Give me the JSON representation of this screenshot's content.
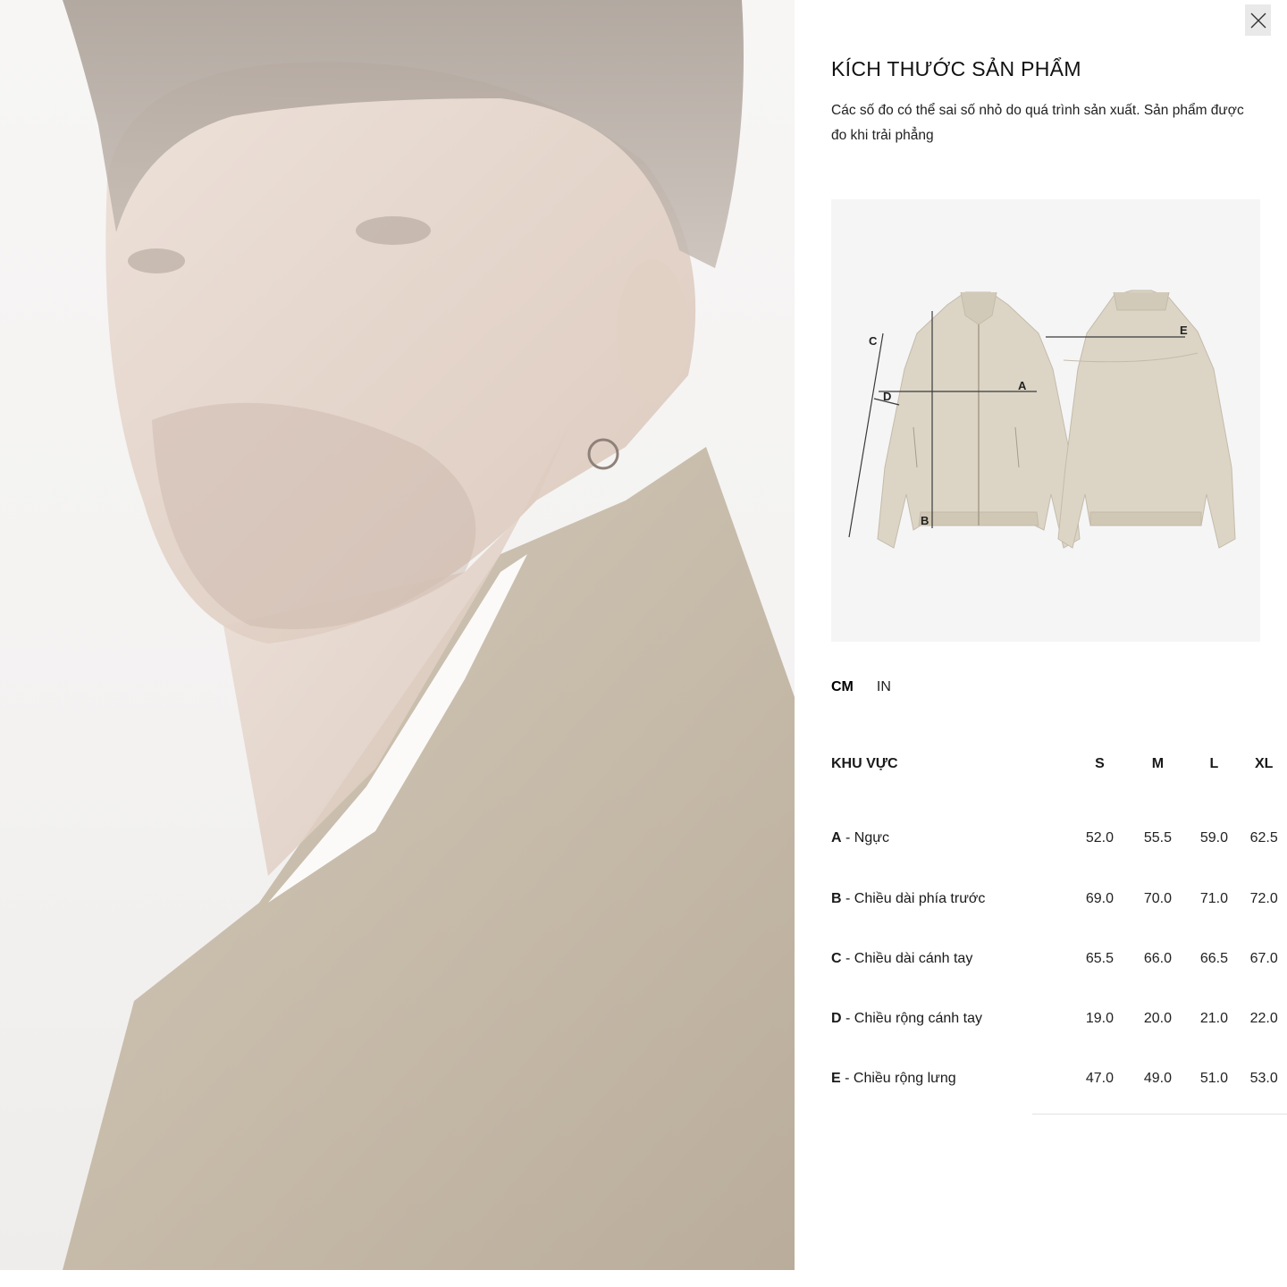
{
  "modal": {
    "title": "KÍCH THƯỚC SẢN PHẨM",
    "description": "Các số đo có thể sai số nhỏ do quá trình sản xuất. Sản phẩm được đo khi trải phẳng",
    "close_icon": "close-icon"
  },
  "diagram": {
    "labels": {
      "a": "A",
      "b": "B",
      "c": "C",
      "d": "D",
      "e": "E"
    },
    "jacket_color": "#d9d2c3"
  },
  "units": {
    "cm": "CM",
    "in": "IN",
    "selected": "cm"
  },
  "table": {
    "region_header": "KHU VỰC",
    "sizes": [
      "S",
      "M",
      "L",
      "XL"
    ],
    "rows": [
      {
        "key": "A",
        "name": " - Ngực",
        "values": [
          "52.0",
          "55.5",
          "59.0",
          "62.5"
        ]
      },
      {
        "key": "B",
        "name": " - Chiều dài phía trước",
        "values": [
          "69.0",
          "70.0",
          "71.0",
          "72.0"
        ]
      },
      {
        "key": "C",
        "name": " - Chiều dài cánh tay",
        "values": [
          "65.5",
          "66.0",
          "66.5",
          "67.0"
        ]
      },
      {
        "key": "D",
        "name": " - Chiều rộng cánh tay",
        "values": [
          "19.0",
          "20.0",
          "21.0",
          "22.0"
        ]
      },
      {
        "key": "E",
        "name": " - Chiều rộng lưng",
        "values": [
          "47.0",
          "49.0",
          "51.0",
          "53.0"
        ]
      }
    ]
  }
}
